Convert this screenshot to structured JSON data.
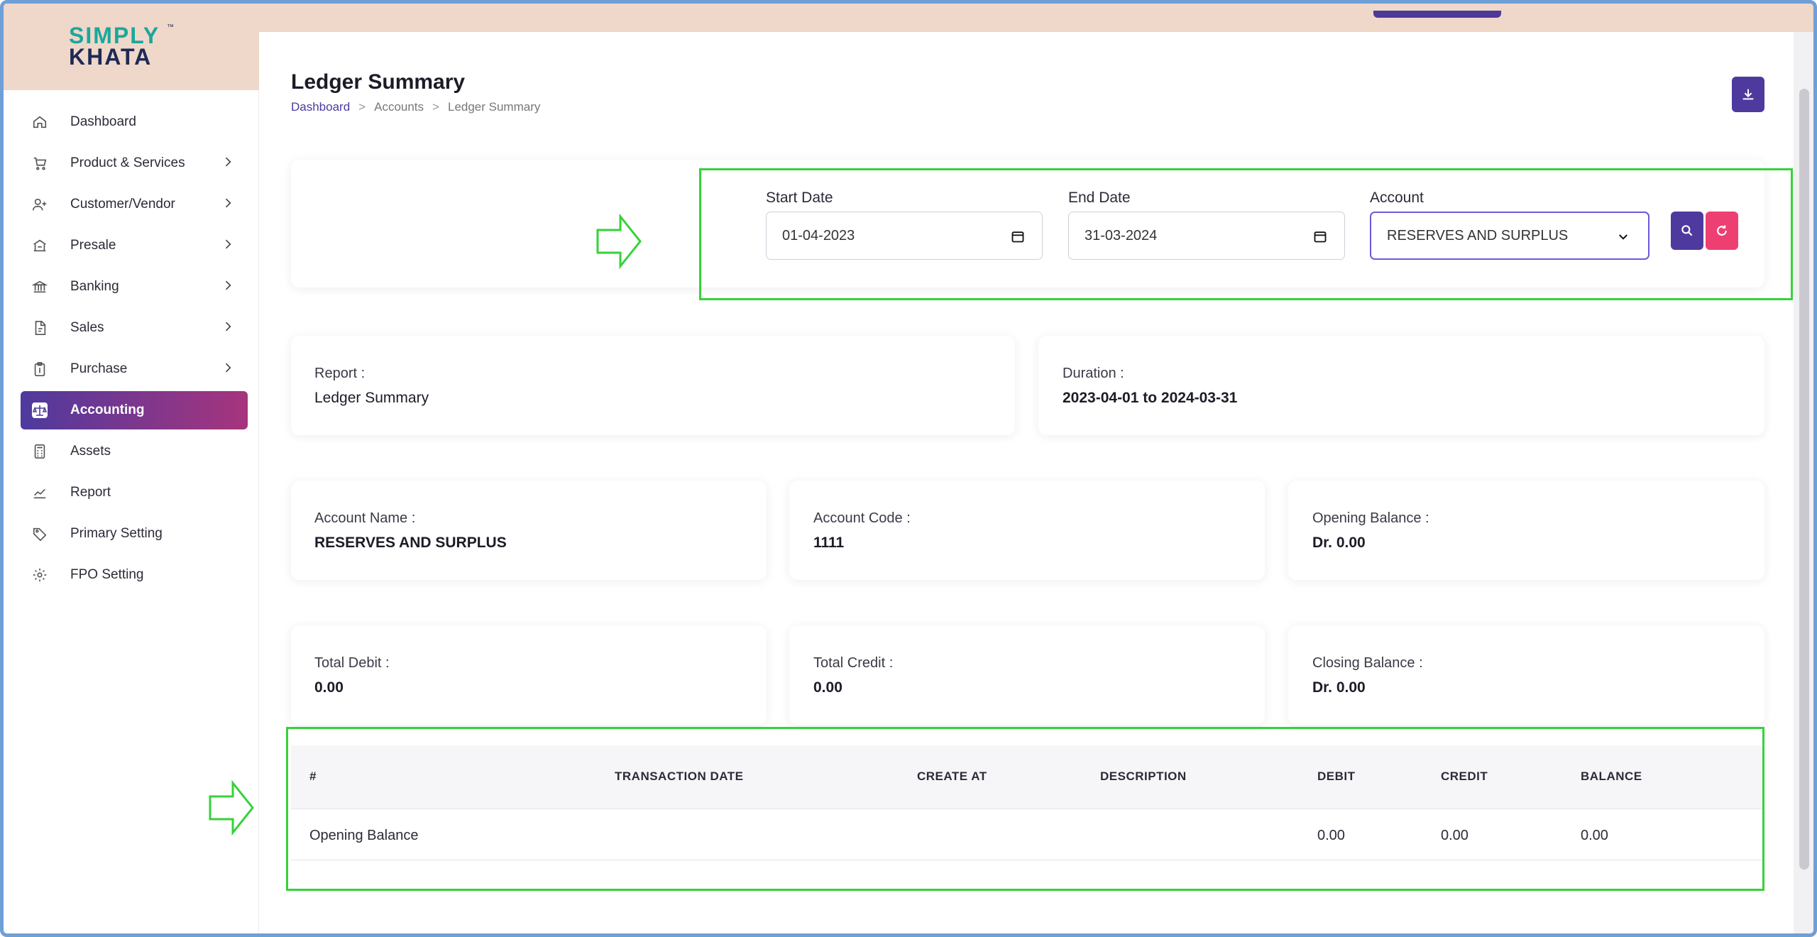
{
  "brand": {
    "line1": "SIMPLY",
    "line2": "KHATA",
    "tm": "™"
  },
  "sidebar": {
    "items": [
      {
        "label": "Dashboard",
        "icon": "home-icon",
        "has_chevron": false,
        "active": false
      },
      {
        "label": "Product & Services",
        "icon": "cart-icon",
        "has_chevron": true,
        "active": false
      },
      {
        "label": "Customer/Vendor",
        "icon": "user-plus-icon",
        "has_chevron": true,
        "active": false
      },
      {
        "label": "Presale",
        "icon": "building-icon",
        "has_chevron": true,
        "active": false
      },
      {
        "label": "Banking",
        "icon": "bank-icon",
        "has_chevron": true,
        "active": false
      },
      {
        "label": "Sales",
        "icon": "file-icon",
        "has_chevron": true,
        "active": false
      },
      {
        "label": "Purchase",
        "icon": "clipboard-icon",
        "has_chevron": true,
        "active": false
      },
      {
        "label": "Accounting",
        "icon": "scale-icon",
        "has_chevron": false,
        "active": true
      },
      {
        "label": "Assets",
        "icon": "calculator-icon",
        "has_chevron": false,
        "active": false
      },
      {
        "label": "Report",
        "icon": "chart-icon",
        "has_chevron": false,
        "active": false
      },
      {
        "label": "Primary Setting",
        "icon": "tag-icon",
        "has_chevron": false,
        "active": false
      },
      {
        "label": "FPO Setting",
        "icon": "gear-icon",
        "has_chevron": false,
        "active": false
      }
    ]
  },
  "page": {
    "title": "Ledger Summary",
    "breadcrumb": [
      "Dashboard",
      "Accounts",
      "Ledger Summary"
    ],
    "sep": ">"
  },
  "filters": {
    "start_date": {
      "label": "Start Date",
      "value": "01-04-2023"
    },
    "end_date": {
      "label": "End Date",
      "value": "31-03-2024"
    },
    "account": {
      "label": "Account",
      "value": "RESERVES AND SURPLUS"
    }
  },
  "summary": {
    "report": {
      "label": "Report :",
      "value": "Ledger Summary"
    },
    "duration": {
      "label": "Duration :",
      "value": "2023-04-01 to 2024-03-31"
    },
    "account_name": {
      "label": "Account Name :",
      "value": "RESERVES AND SURPLUS"
    },
    "account_code": {
      "label": "Account Code :",
      "value": "1111"
    },
    "opening_balance": {
      "label": "Opening Balance :",
      "value": "Dr. 0.00"
    },
    "total_debit": {
      "label": "Total Debit :",
      "value": "0.00"
    },
    "total_credit": {
      "label": "Total Credit :",
      "value": "0.00"
    },
    "closing_balance": {
      "label": "Closing Balance :",
      "value": "Dr. 0.00"
    }
  },
  "table": {
    "columns": [
      "#",
      "TRANSACTION DATE",
      "CREATE AT",
      "DESCRIPTION",
      "DEBIT",
      "CREDIT",
      "BALANCE"
    ],
    "rows": [
      [
        "Opening Balance",
        "",
        "",
        "",
        "0.00",
        "0.00",
        "0.00"
      ]
    ]
  },
  "colors": {
    "primary": "#4e3a9e",
    "accent_pink": "#ee3f72",
    "highlight_green": "#36d23a",
    "topbar": "#efd7c9"
  }
}
